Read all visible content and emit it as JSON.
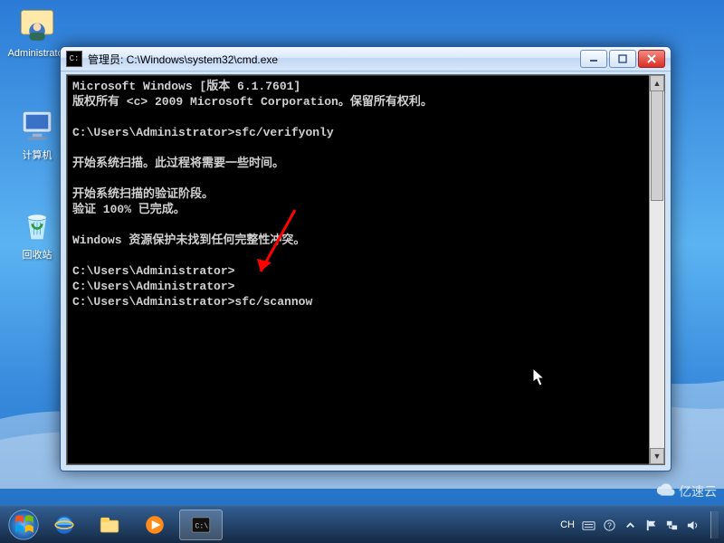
{
  "desktop": {
    "icons": [
      {
        "name": "administrator-icon",
        "label": "Administrator"
      },
      {
        "name": "computer-icon",
        "label": "计算机"
      },
      {
        "name": "recycle-bin-icon",
        "label": "回收站"
      }
    ]
  },
  "window": {
    "title": "管理员: C:\\Windows\\system32\\cmd.exe",
    "lines": [
      "Microsoft Windows [版本 6.1.7601]",
      "版权所有 <c> 2009 Microsoft Corporation。保留所有权利。",
      "",
      "C:\\Users\\Administrator>sfc/verifyonly",
      "",
      "开始系统扫描。此过程将需要一些时间。",
      "",
      "开始系统扫描的验证阶段。",
      "验证 100% 已完成。",
      "",
      "Windows 资源保护未找到任何完整性冲突。",
      "",
      "C:\\Users\\Administrator>",
      "C:\\Users\\Administrator>",
      "C:\\Users\\Administrator>sfc/scannow"
    ]
  },
  "taskbar": {
    "items": [
      {
        "name": "ie-icon"
      },
      {
        "name": "explorer-icon"
      },
      {
        "name": "media-player-icon"
      },
      {
        "name": "cmd-task-icon"
      }
    ],
    "tray": {
      "ime": "CH",
      "showdesktop": true
    }
  },
  "watermark": "亿速云"
}
